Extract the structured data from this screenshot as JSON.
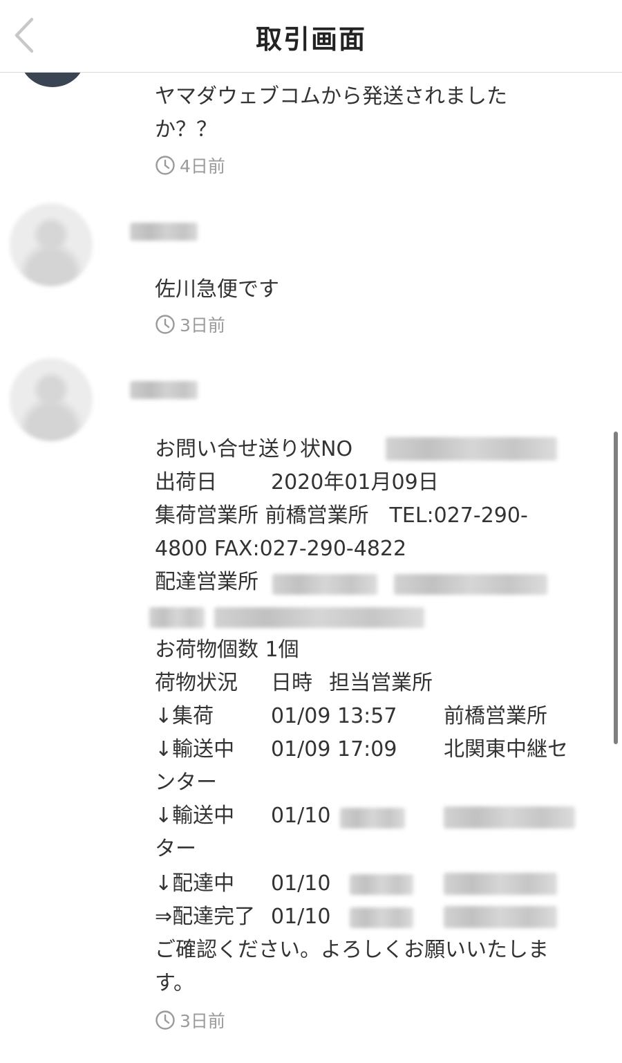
{
  "header": {
    "title": "取引画面"
  },
  "messages": [
    {
      "lines": [
        "ヤマダウェブコムから発送されました",
        "か？？"
      ],
      "time": "4日前"
    },
    {
      "lines": [
        "佐川急便です"
      ],
      "time": "3日前"
    },
    {
      "detail": {
        "inquiry_label": "お問い合せ送り状NO",
        "ship_date_label": "出荷日",
        "ship_date": "2020年01月09日",
        "origin_line1": "集荷営業所 前橋営業所　TEL:027-290-",
        "origin_line2": "4800 FAX:027-290-4822",
        "delivery_office_label": "配達営業所",
        "package_count": "お荷物個数 1個",
        "status_header_label": "荷物状況",
        "status_header_datetime": "日時",
        "status_header_office": "担当営業所",
        "rows": [
          {
            "status": "↓集荷",
            "datetime": "01/09 13:57",
            "office": "前橋営業所"
          },
          {
            "status": "↓輸送中",
            "datetime": "01/09 17:09",
            "office": "北関東中継セ"
          },
          {
            "status": "ンター",
            "datetime": "",
            "office": ""
          },
          {
            "status": "↓輸送中",
            "datetime": "01/10",
            "office": ""
          },
          {
            "status": "ター",
            "datetime": "",
            "office": ""
          },
          {
            "status": "↓配達中",
            "datetime": "01/10",
            "office": ""
          },
          {
            "status": "⇒配達完了",
            "datetime": "01/10",
            "office": ""
          }
        ],
        "closing_line1": "ご確認ください。よろしくお願いいたしま",
        "closing_line2": "す。"
      },
      "time": "3日前"
    }
  ],
  "icons": {
    "back": "chevron-left-icon",
    "clock": "clock-icon"
  },
  "colors": {
    "text": "#333333",
    "time": "#9a9a9a",
    "avatar_dark": "#3b4452",
    "back_arrow": "#c8c8c8"
  }
}
